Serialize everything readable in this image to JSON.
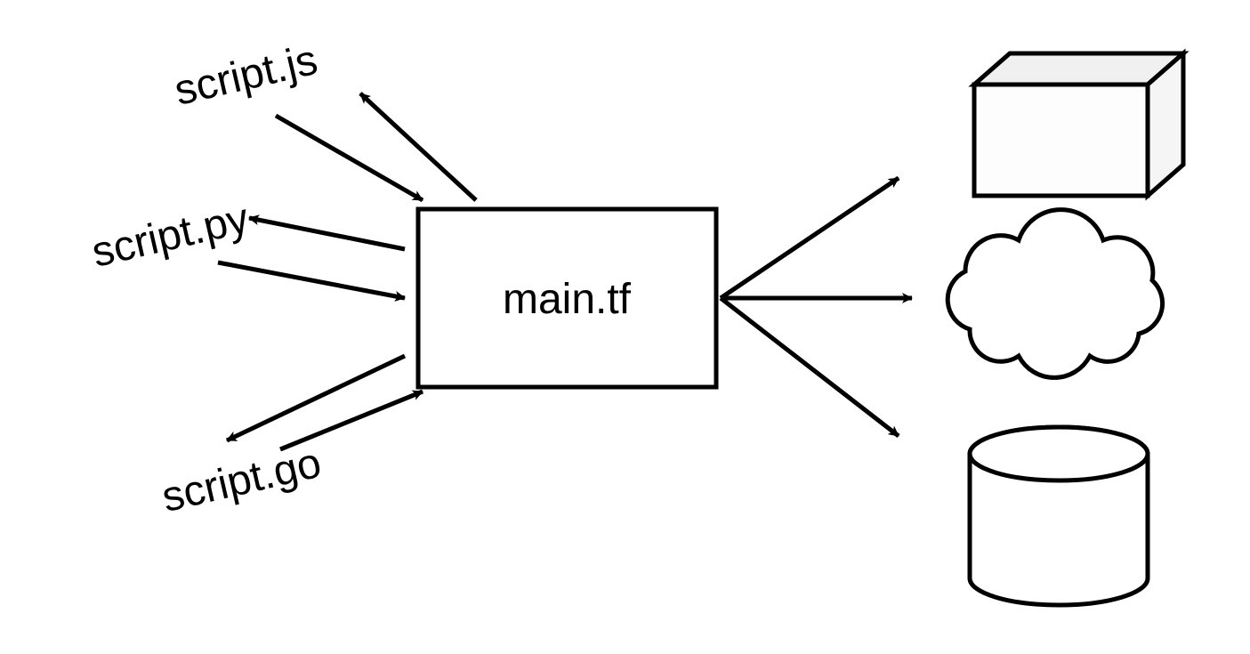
{
  "scripts": {
    "js": "script.js",
    "py": "script.py",
    "go": "script.go"
  },
  "main": {
    "label": "main.tf"
  }
}
